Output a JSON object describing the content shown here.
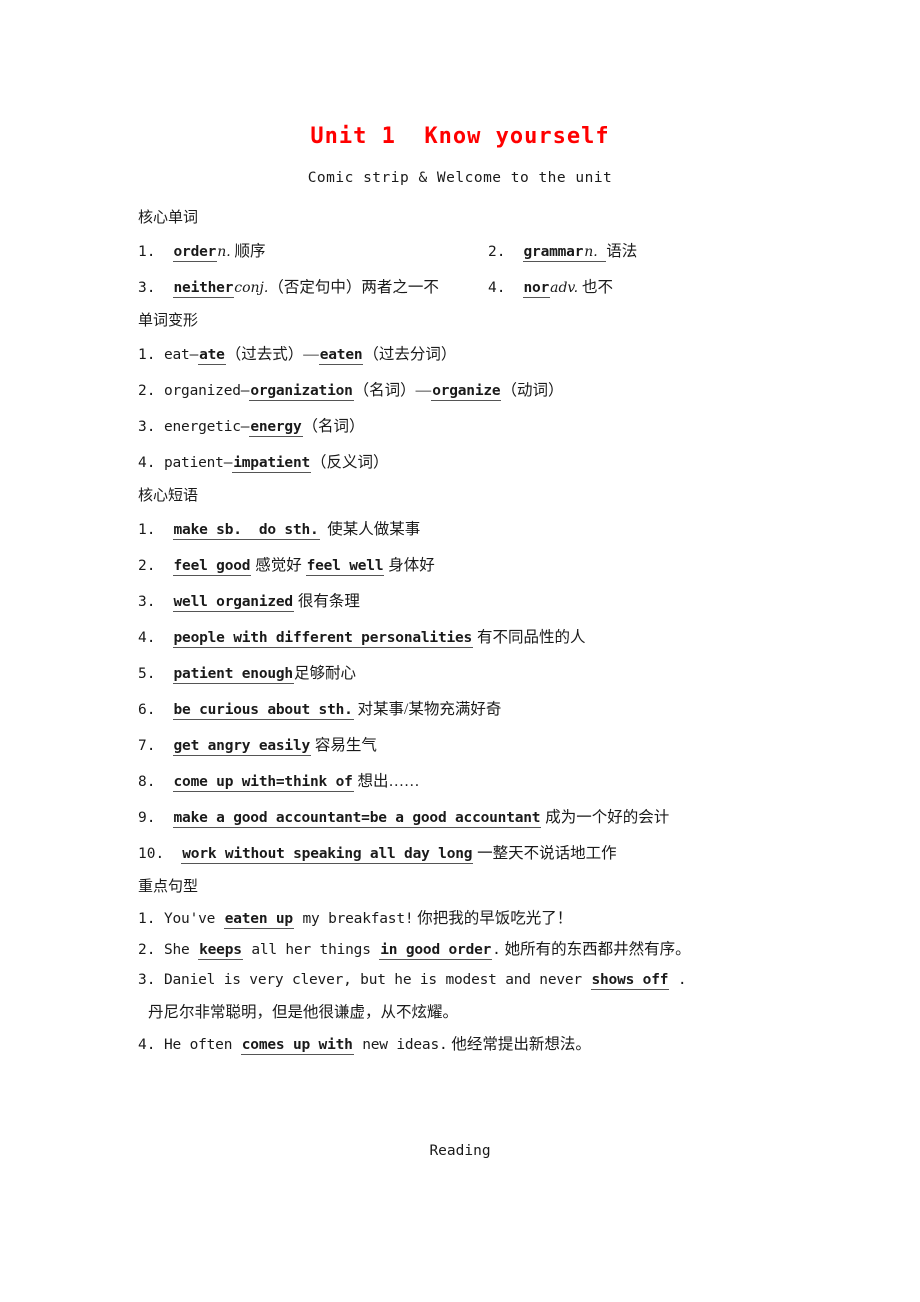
{
  "doc": {
    "title": "Unit 1  Know yourself",
    "title_color": "#ff0000",
    "subtitle": "Comic strip & Welcome to the unit",
    "footer": "Reading"
  },
  "sections": {
    "core_words": {
      "heading": "核心单词",
      "items": [
        {
          "num": "1.",
          "answer": "order",
          "pos": "n.",
          "gloss": "顺序"
        },
        {
          "num": "2.",
          "answer": "grammar",
          "pos": "n.",
          "gloss": "语法"
        },
        {
          "num": "3.",
          "answer": "neither",
          "pos": "conj.",
          "gloss": "（否定句中）两者之一不"
        },
        {
          "num": "4.",
          "answer": "nor",
          "pos": "adv.",
          "gloss": "也不"
        }
      ]
    },
    "word_forms": {
      "heading": "单词变形",
      "items": [
        {
          "num": "1.",
          "stem": "eat—",
          "answer1": "ate",
          "tag1": "（过去式）—",
          "answer2": "eaten",
          "tag2": "（过去分词）"
        },
        {
          "num": "2.",
          "stem": "organized—",
          "answer1": "organization",
          "tag1": "（名词）—",
          "answer2": "organize",
          "tag2": "（动词）"
        },
        {
          "num": "3.",
          "stem": "energetic—",
          "answer1": "energy",
          "tag1": "（名词）",
          "answer2": "",
          "tag2": ""
        },
        {
          "num": "4.",
          "stem": "patient—",
          "answer1": "impatient",
          "tag1": "（反义词）",
          "answer2": "",
          "tag2": ""
        }
      ]
    },
    "core_phrases": {
      "heading": "核心短语",
      "items": [
        {
          "num": "1.",
          "answer": "make sb.  do sth.",
          "gloss": "使某人做某事",
          "answer2": "",
          "gloss2": ""
        },
        {
          "num": "2.",
          "answer": "feel good",
          "gloss": "感觉好",
          "answer2": "feel well",
          "gloss2": "身体好"
        },
        {
          "num": "3.",
          "answer": "well organized",
          "gloss": "很有条理",
          "answer2": "",
          "gloss2": ""
        },
        {
          "num": "4.",
          "answer": "people with different personalities",
          "gloss": "有不同品性的人",
          "answer2": "",
          "gloss2": ""
        },
        {
          "num": "5.",
          "answer": "patient enough",
          "gloss": "足够耐心",
          "answer2": "",
          "gloss2": ""
        },
        {
          "num": "6.",
          "answer": "be curious about sth.",
          "gloss": "对某事/某物充满好奇",
          "answer2": "",
          "gloss2": ""
        },
        {
          "num": "7.",
          "answer": "get angry easily",
          "gloss": "容易生气",
          "answer2": "",
          "gloss2": ""
        },
        {
          "num": "8.",
          "answer": "come up with=think of",
          "gloss": "想出……",
          "answer2": "",
          "gloss2": ""
        },
        {
          "num": "9.",
          "answer": "make a good accountant=be a good accountant",
          "gloss": "成为一个好的会计",
          "answer2": "",
          "gloss2": ""
        },
        {
          "num": "10.",
          "answer": "work without speaking all day long",
          "gloss": "一整天不说话地工作",
          "answer2": "",
          "gloss2": ""
        }
      ]
    },
    "key_sentences": {
      "heading": "重点句型",
      "items": [
        {
          "num": "1.",
          "pre": "You've",
          "answer": "eaten up",
          "mid": "my breakfast!",
          "answer2": "",
          "post": "",
          "gloss": "你把我的早饭吃光了！",
          "cont": ""
        },
        {
          "num": "2.",
          "pre": "She",
          "answer": "keeps",
          "mid": "all her things",
          "answer2": "in good order",
          "post": ".",
          "gloss": "她所有的东西都井然有序。",
          "cont": ""
        },
        {
          "num": "3.",
          "pre": "Daniel is very clever, but he is modest and never",
          "answer": "shows off",
          "mid": "",
          "answer2": "",
          "post": ".",
          "gloss": "",
          "cont": "丹尼尔非常聪明，但是他很谦虚，从不炫耀。"
        },
        {
          "num": "4.",
          "pre": "He often",
          "answer": "comes up with",
          "mid": "new ideas.",
          "answer2": "",
          "post": "",
          "gloss": "他经常提出新想法。",
          "cont": ""
        }
      ]
    }
  }
}
